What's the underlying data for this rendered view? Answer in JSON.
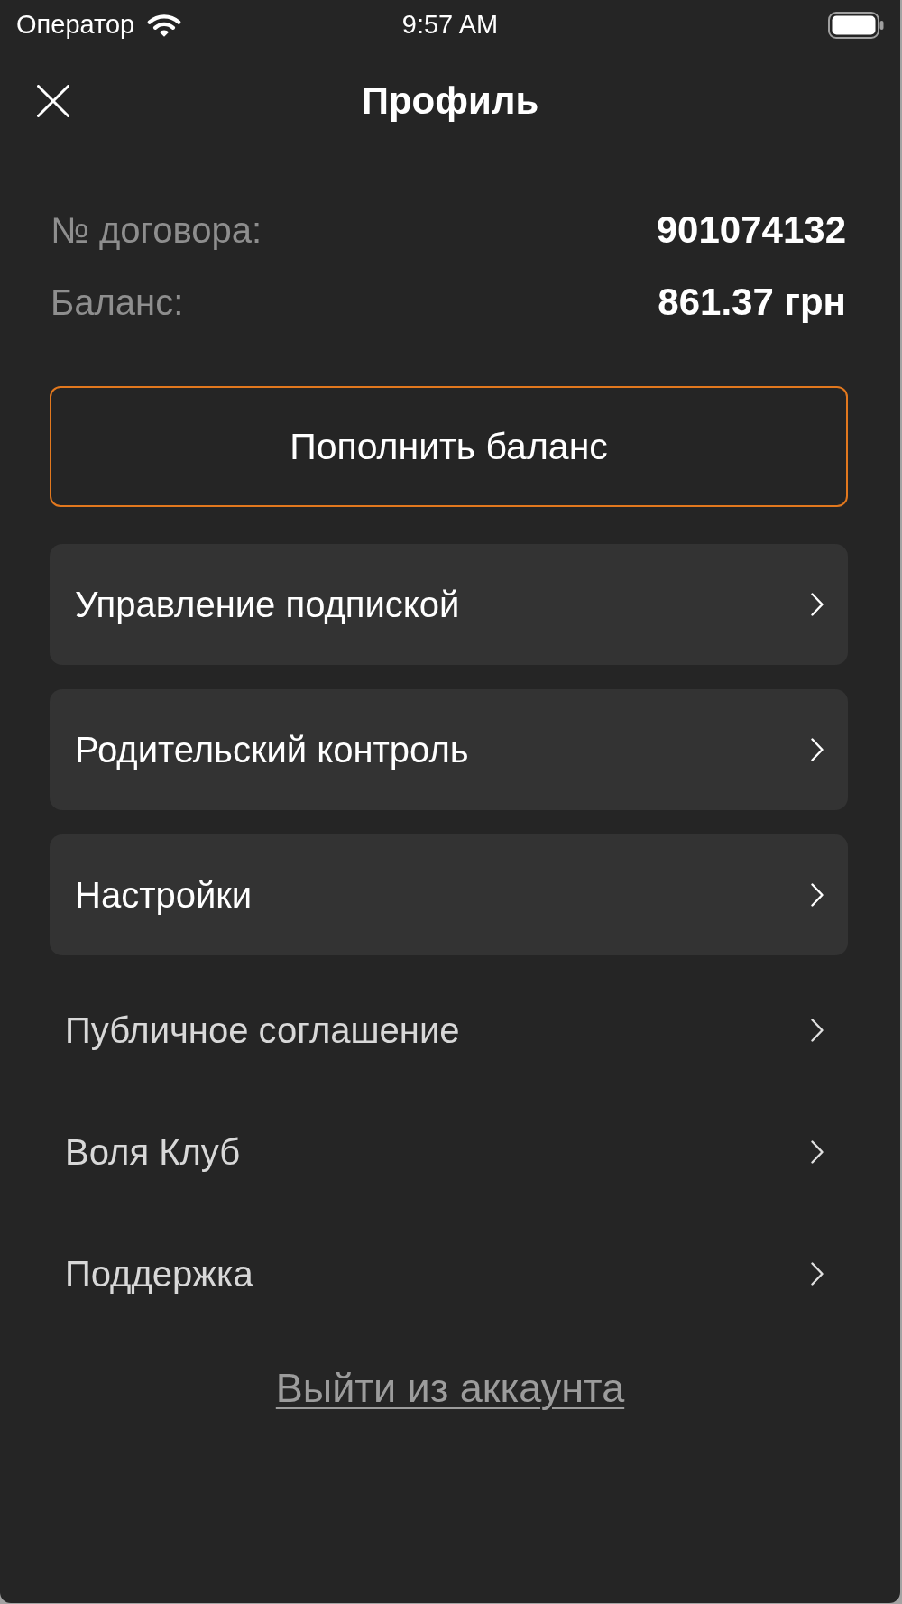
{
  "status_bar": {
    "carrier": "Оператор",
    "time": "9:57 AM"
  },
  "header": {
    "title": "Профиль"
  },
  "account": [
    {
      "label": "№ договора:",
      "value": "901074132"
    },
    {
      "label": "Баланс:",
      "value": "861.37 грн"
    }
  ],
  "top_up_button": "Пополнить баланс",
  "menu": [
    {
      "label": "Управление подпиской",
      "kind": "card"
    },
    {
      "label": "Родительский контроль",
      "kind": "card"
    },
    {
      "label": "Настройки",
      "kind": "card"
    },
    {
      "label": "Публичное соглашение",
      "kind": "plain"
    },
    {
      "label": "Воля Клуб",
      "kind": "plain"
    },
    {
      "label": "Поддержка",
      "kind": "plain"
    }
  ],
  "logout_link": "Выйти из аккаунта"
}
